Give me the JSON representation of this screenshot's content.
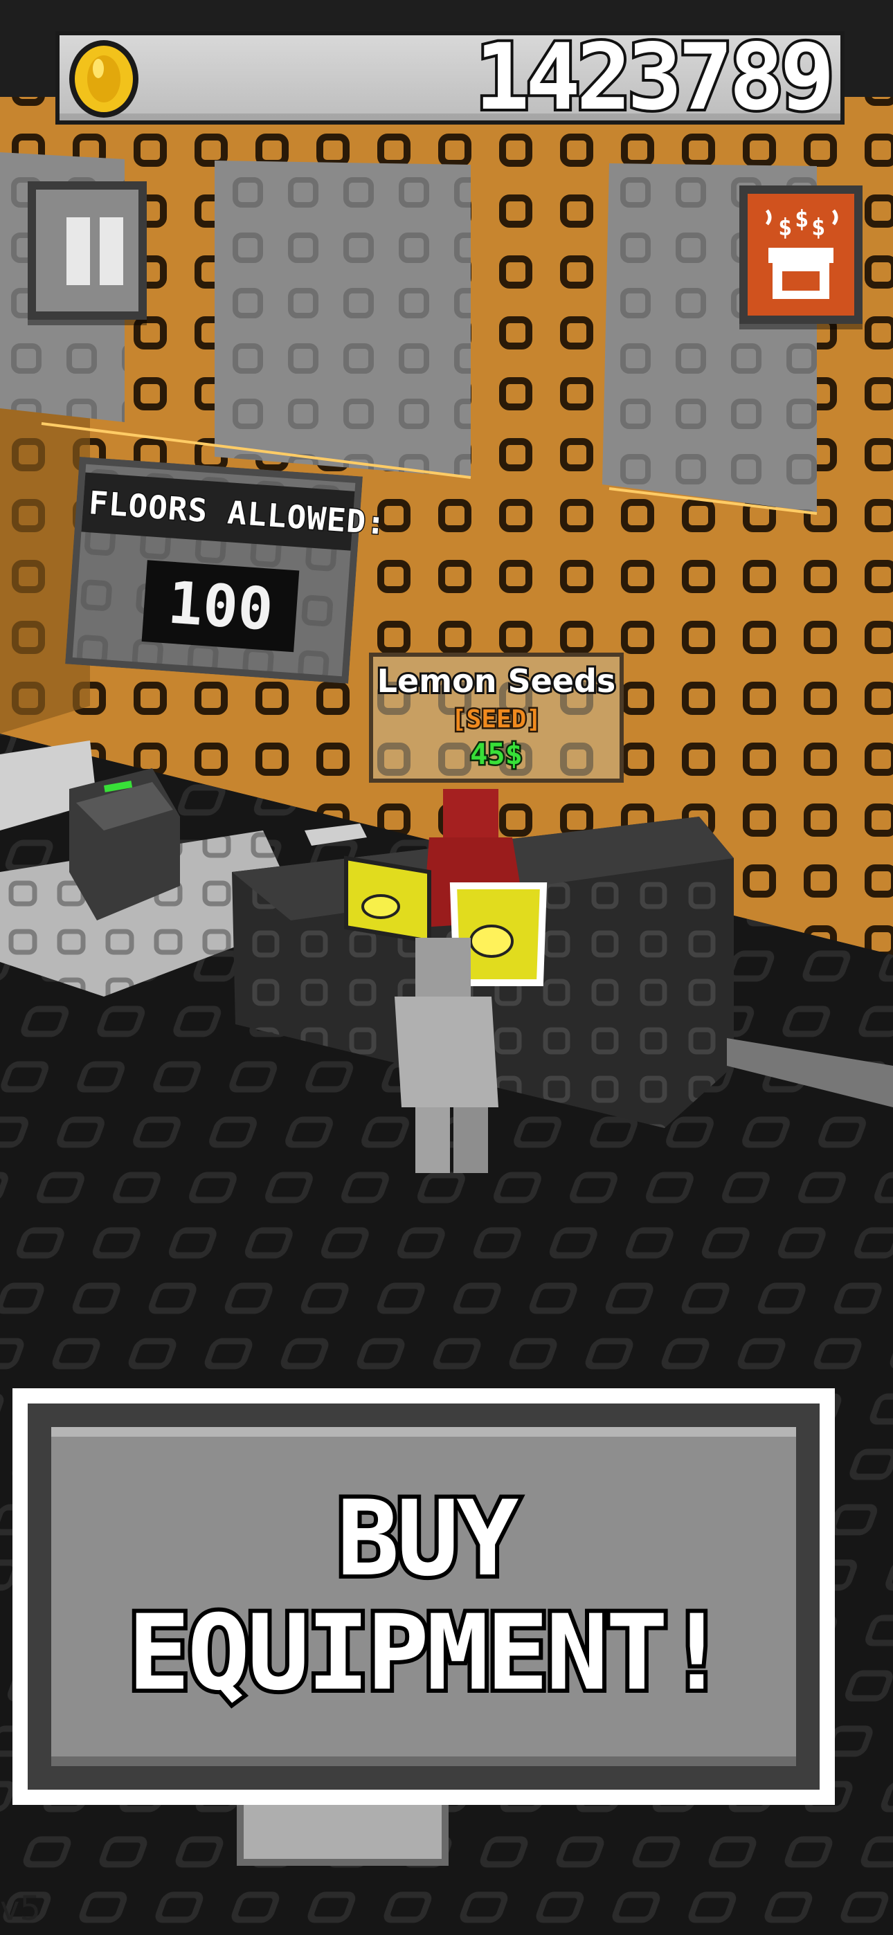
{
  "hud": {
    "coins": "1423789",
    "coin_icon": "gold-coin-icon",
    "pause_icon": "pause-icon",
    "shop_icon": "popcorn-shop-icon"
  },
  "world_sign": {
    "label": "FLOORS ALLOWED:",
    "value": "100"
  },
  "item_tooltip": {
    "name": "Lemon Seeds",
    "type": "[SEED]",
    "price": "45$"
  },
  "actions": {
    "buy_label": "BUY\nEQUIPMENT!"
  },
  "footer": {
    "version": "v5"
  },
  "colors": {
    "wall_orange": "#c8852f",
    "coin_gold": "#f2c21b",
    "shop_orange": "#d0521e",
    "price_green": "#38e038",
    "seed_yellow": "#e4e020"
  }
}
